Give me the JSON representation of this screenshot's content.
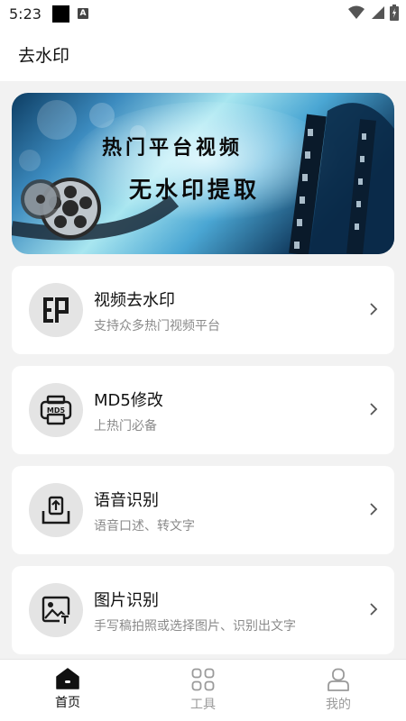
{
  "status_bar": {
    "time": "5:23",
    "notif_letter": "A"
  },
  "app_bar": {
    "title": "去水印"
  },
  "banner": {
    "line1": "热门平台视频",
    "line2": "无水印提取"
  },
  "cards": [
    {
      "title": "视频去水印",
      "subtitle": "支持众多热门视频平台",
      "icon": "watermark-icon"
    },
    {
      "title": "MD5修改",
      "subtitle": "上热门必备",
      "icon": "md5-printer-icon"
    },
    {
      "title": "语音识别",
      "subtitle": "语音口述、转文字",
      "icon": "upload-tray-icon"
    },
    {
      "title": "图片识别",
      "subtitle": "手写稿拍照或选择图片、识别出文字",
      "icon": "image-text-icon"
    }
  ],
  "nav": [
    {
      "label": "首页",
      "icon": "home-icon",
      "active": true
    },
    {
      "label": "工具",
      "icon": "grid-icon",
      "active": false
    },
    {
      "label": "我的",
      "icon": "person-icon",
      "active": false
    }
  ],
  "colors": {
    "active": "#111111",
    "inactive": "#9a9a9a",
    "banner_dark": "#0b3a5e",
    "banner_light": "#a8e6f0"
  }
}
